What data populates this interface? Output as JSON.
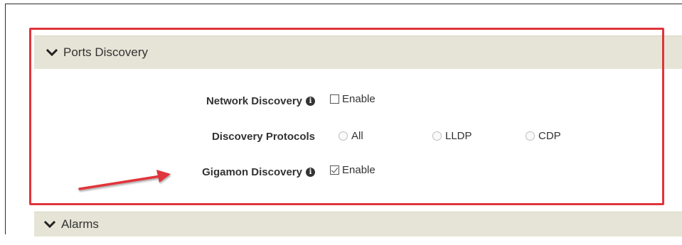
{
  "sections": {
    "ports_discovery": {
      "title": "Ports Discovery",
      "expanded": true
    },
    "alarms": {
      "title": "Alarms"
    }
  },
  "form": {
    "network_discovery": {
      "label": "Network Discovery",
      "option_label": "Enable",
      "checked": false
    },
    "discovery_protocols": {
      "label": "Discovery Protocols",
      "options": [
        {
          "label": "All",
          "selected": false
        },
        {
          "label": "LLDP",
          "selected": false
        },
        {
          "label": "CDP",
          "selected": false
        }
      ]
    },
    "gigamon_discovery": {
      "label": "Gigamon Discovery",
      "option_label": "Enable",
      "checked": true
    }
  },
  "colors": {
    "header_bg": "#e6e4d6",
    "highlight_red": "#e0343b"
  },
  "icons": {
    "section_toggle": "chevron-down-icon",
    "info": "info-icon"
  }
}
